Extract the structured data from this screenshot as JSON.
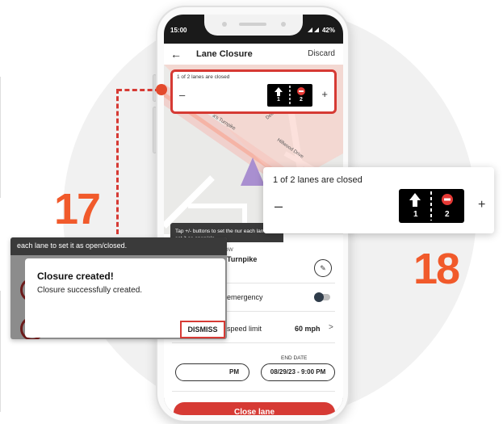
{
  "status_bar": {
    "time": "15:00",
    "right": "42%"
  },
  "app_bar": {
    "title": "Lane Closure",
    "discard": "Discard"
  },
  "lane_card": {
    "text": "1 of 2 lanes are closed",
    "minus": "–",
    "plus": "+",
    "lane_1": "1",
    "lane_2": "2"
  },
  "map": {
    "streets": [
      "Dell",
      "Hillwood Drive",
      "a's Turnpike"
    ]
  },
  "tooltip": {
    "text": "Tap +/- buttons to set the nur each lane to set it as open/clo"
  },
  "form": {
    "starts_label": "STARTS NOW",
    "road": "Turnpike",
    "emergency": "emergency",
    "speed_limit": "speed limit",
    "speed_value": "60 mph",
    "end_date_label": "END DATE",
    "start_pill": "PM",
    "end_pill": "08/29/23 - 9:00 PM",
    "close_button": "Close lane"
  },
  "dialog": {
    "top_text": "each lane to set it as open/closed.",
    "title": "Closure created!",
    "message": "Closure successfully created.",
    "dismiss": "DISMISS"
  },
  "callout": {
    "text": "1 of 2 lanes are closed",
    "minus": "–",
    "plus": "+",
    "lane_1": "1",
    "lane_2": "2"
  },
  "steps": {
    "left": "17",
    "right": "18"
  },
  "colors": {
    "accent": "#d63a34",
    "step_number": "#f15a2b",
    "background_circle": "#f1f1f1"
  }
}
